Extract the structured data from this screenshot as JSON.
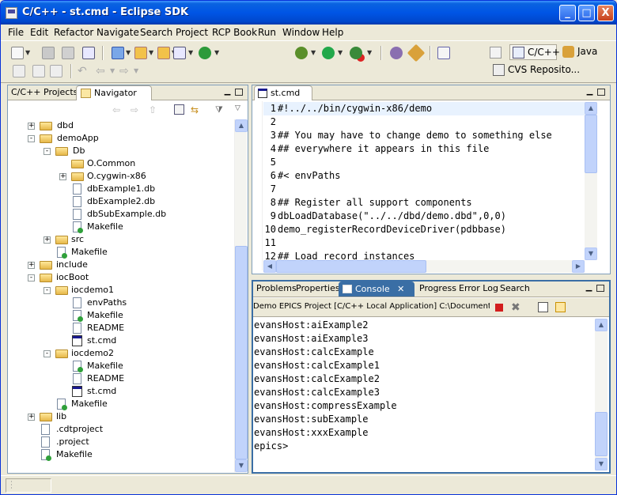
{
  "window": {
    "title": "C/C++ - st.cmd - Eclipse SDK",
    "min": "_",
    "max": "□",
    "close": "X"
  },
  "menu": [
    "File",
    "Edit",
    "Refactor",
    "Navigate",
    "Search",
    "Project",
    "RCP Book",
    "Run",
    "Window",
    "Help"
  ],
  "perspectives": {
    "cpp": "C/C++",
    "java": "Java",
    "cvs": "CVS Reposito..."
  },
  "left_tabs": {
    "cpp_projects": "C/C++ Projects",
    "navigator": "Navigator"
  },
  "tree": [
    {
      "label": "dbd",
      "type": "folder",
      "expander": "+"
    },
    {
      "label": "demoApp",
      "type": "folder",
      "expander": "-"
    },
    {
      "label": "Db",
      "type": "folder",
      "expander": "-"
    },
    {
      "label": "O.Common",
      "type": "folder",
      "expander": ""
    },
    {
      "label": "O.cygwin-x86",
      "type": "folder",
      "expander": "+"
    },
    {
      "label": "dbExample1.db",
      "type": "file",
      "expander": ""
    },
    {
      "label": "dbExample2.db",
      "type": "file",
      "expander": ""
    },
    {
      "label": "dbSubExample.db",
      "type": "file",
      "expander": ""
    },
    {
      "label": "Makefile",
      "type": "make",
      "expander": ""
    },
    {
      "label": "src",
      "type": "folder",
      "expander": "+"
    },
    {
      "label": "Makefile",
      "type": "make",
      "expander": ""
    },
    {
      "label": "include",
      "type": "folder",
      "expander": "+"
    },
    {
      "label": "iocBoot",
      "type": "folder",
      "expander": "-"
    },
    {
      "label": "iocdemo1",
      "type": "folder",
      "expander": "-"
    },
    {
      "label": "envPaths",
      "type": "file",
      "expander": ""
    },
    {
      "label": "Makefile",
      "type": "make",
      "expander": ""
    },
    {
      "label": "README",
      "type": "file",
      "expander": ""
    },
    {
      "label": "st.cmd",
      "type": "cmd",
      "expander": ""
    },
    {
      "label": "iocdemo2",
      "type": "folder",
      "expander": "-"
    },
    {
      "label": "Makefile",
      "type": "make",
      "expander": ""
    },
    {
      "label": "README",
      "type": "file",
      "expander": ""
    },
    {
      "label": "st.cmd",
      "type": "cmd",
      "expander": ""
    },
    {
      "label": "Makefile",
      "type": "make",
      "expander": ""
    },
    {
      "label": "lib",
      "type": "folder",
      "expander": "+"
    },
    {
      "label": ".cdtproject",
      "type": "file",
      "expander": ""
    },
    {
      "label": ".project",
      "type": "file",
      "expander": ""
    },
    {
      "label": "Makefile",
      "type": "make",
      "expander": ""
    }
  ],
  "editor": {
    "tab": "st.cmd",
    "lines": [
      {
        "n": "1",
        "text": "#!../../bin/cygwin-x86/demo"
      },
      {
        "n": "2",
        "text": ""
      },
      {
        "n": "3",
        "text": "## You may have to change demo to something else"
      },
      {
        "n": "4",
        "text": "## everywhere it appears in this file"
      },
      {
        "n": "5",
        "text": ""
      },
      {
        "n": "6",
        "text": "#< envPaths"
      },
      {
        "n": "7",
        "text": ""
      },
      {
        "n": "8",
        "text": "## Register all support components"
      },
      {
        "n": "9",
        "text": "dbLoadDatabase(\"../../dbd/demo.dbd\",0,0)"
      },
      {
        "n": "10",
        "text": "demo_registerRecordDeviceDriver(pdbbase)"
      },
      {
        "n": "11",
        "text": ""
      },
      {
        "n": "12",
        "text": "## Load record instances"
      }
    ]
  },
  "bottom_tabs": [
    "Problems",
    "Properties",
    "Console",
    "Progress",
    "Error Log",
    "Search"
  ],
  "console": {
    "header": "Demo EPICS Project [C/C++ Local Application] C:\\Documents &",
    "lines": [
      "evansHost:aiExample2",
      "evansHost:aiExample3",
      "evansHost:calcExample",
      "evansHost:calcExample1",
      "evansHost:calcExample2",
      "evansHost:calcExample3",
      "evansHost:compressExample",
      "evansHost:subExample",
      "evansHost:xxxExample",
      "epics>"
    ]
  }
}
